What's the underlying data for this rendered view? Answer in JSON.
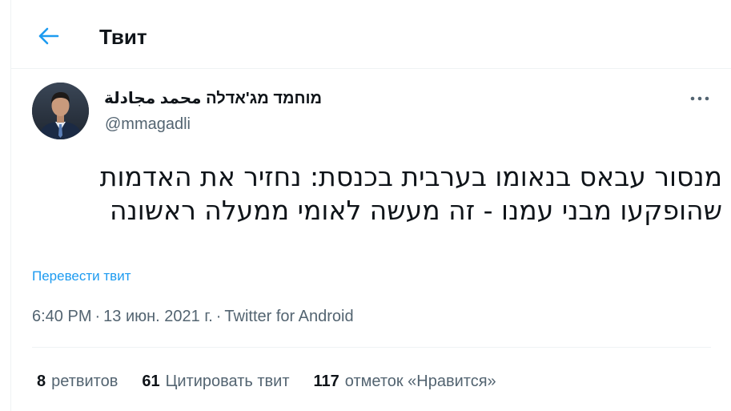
{
  "header": {
    "title": "Твит",
    "back_icon": "arrow-left-icon"
  },
  "tweet": {
    "author": {
      "display_name": "מוחמד מג'אדלה محمد مجادلة",
      "handle": "@mmagadli"
    },
    "more_icon": "more-horizontal-icon",
    "text": "מנסור עבאס בנאומו בערבית בכנסת: נחזיר את האדמות שהופקעו מבני עמנו - זה מעשה לאומי ממעלה ראשונה",
    "translate_label": "Перевести твит",
    "time": "6:40 PM",
    "date": "13 июн. 2021 г.",
    "source": "Twitter for Android",
    "separator": "·"
  },
  "stats": {
    "retweets": {
      "count": "8",
      "label": "ретвитов"
    },
    "quotes": {
      "count": "61",
      "label": "Цитировать твит"
    },
    "likes": {
      "count": "117",
      "label": "отметок «Нравится»"
    }
  },
  "colors": {
    "accent": "#1d9bf0",
    "text_primary": "#0f1419",
    "text_secondary": "#536471",
    "border": "#eff3f4"
  }
}
